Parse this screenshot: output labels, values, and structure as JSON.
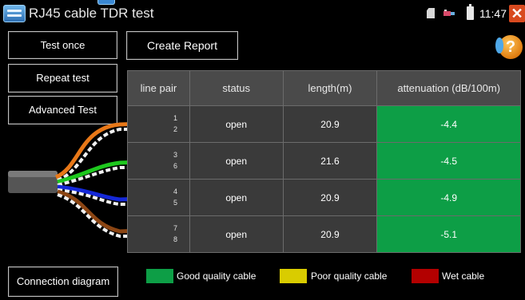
{
  "window": {
    "title": "RJ45 cable TDR test",
    "clock": "11:47 AM",
    "icons": [
      "app-icon",
      "sd-card-icon",
      "usb-icon",
      "battery-icon",
      "close-icon"
    ]
  },
  "buttons": {
    "test_once": "Test once",
    "repeat_test": "Repeat test",
    "advanced_test": "Advanced Test",
    "create_report": "Create Report",
    "connection_diagram": "Connection diagram",
    "help": "?"
  },
  "table": {
    "headers": [
      "line pair",
      "status",
      "length(m)",
      "attenuation (dB/100m)"
    ],
    "rows": [
      {
        "pair_top": "1",
        "pair_bottom": "2",
        "status": "open",
        "length": "20.9",
        "attenuation": "-4.4"
      },
      {
        "pair_top": "3",
        "pair_bottom": "6",
        "status": "open",
        "length": "21.6",
        "attenuation": "-4.5"
      },
      {
        "pair_top": "4",
        "pair_bottom": "5",
        "status": "open",
        "length": "20.9",
        "attenuation": "-4.9"
      },
      {
        "pair_top": "7",
        "pair_bottom": "8",
        "status": "open",
        "length": "20.9",
        "attenuation": "-5.1"
      }
    ],
    "attenuation_color": "#0d9e46"
  },
  "legend": [
    {
      "label": "Good quality cable",
      "color": "#0d9e46"
    },
    {
      "label": "Poor quality cable",
      "color": "#d9cc00"
    },
    {
      "label": "Wet cable",
      "color": "#b30000"
    }
  ],
  "wire_colors": {
    "pair_1_2": "#e87818",
    "pair_3_6": "#1ec81e",
    "pair_4_5": "#1428d8",
    "pair_7_8": "#8b4513"
  }
}
